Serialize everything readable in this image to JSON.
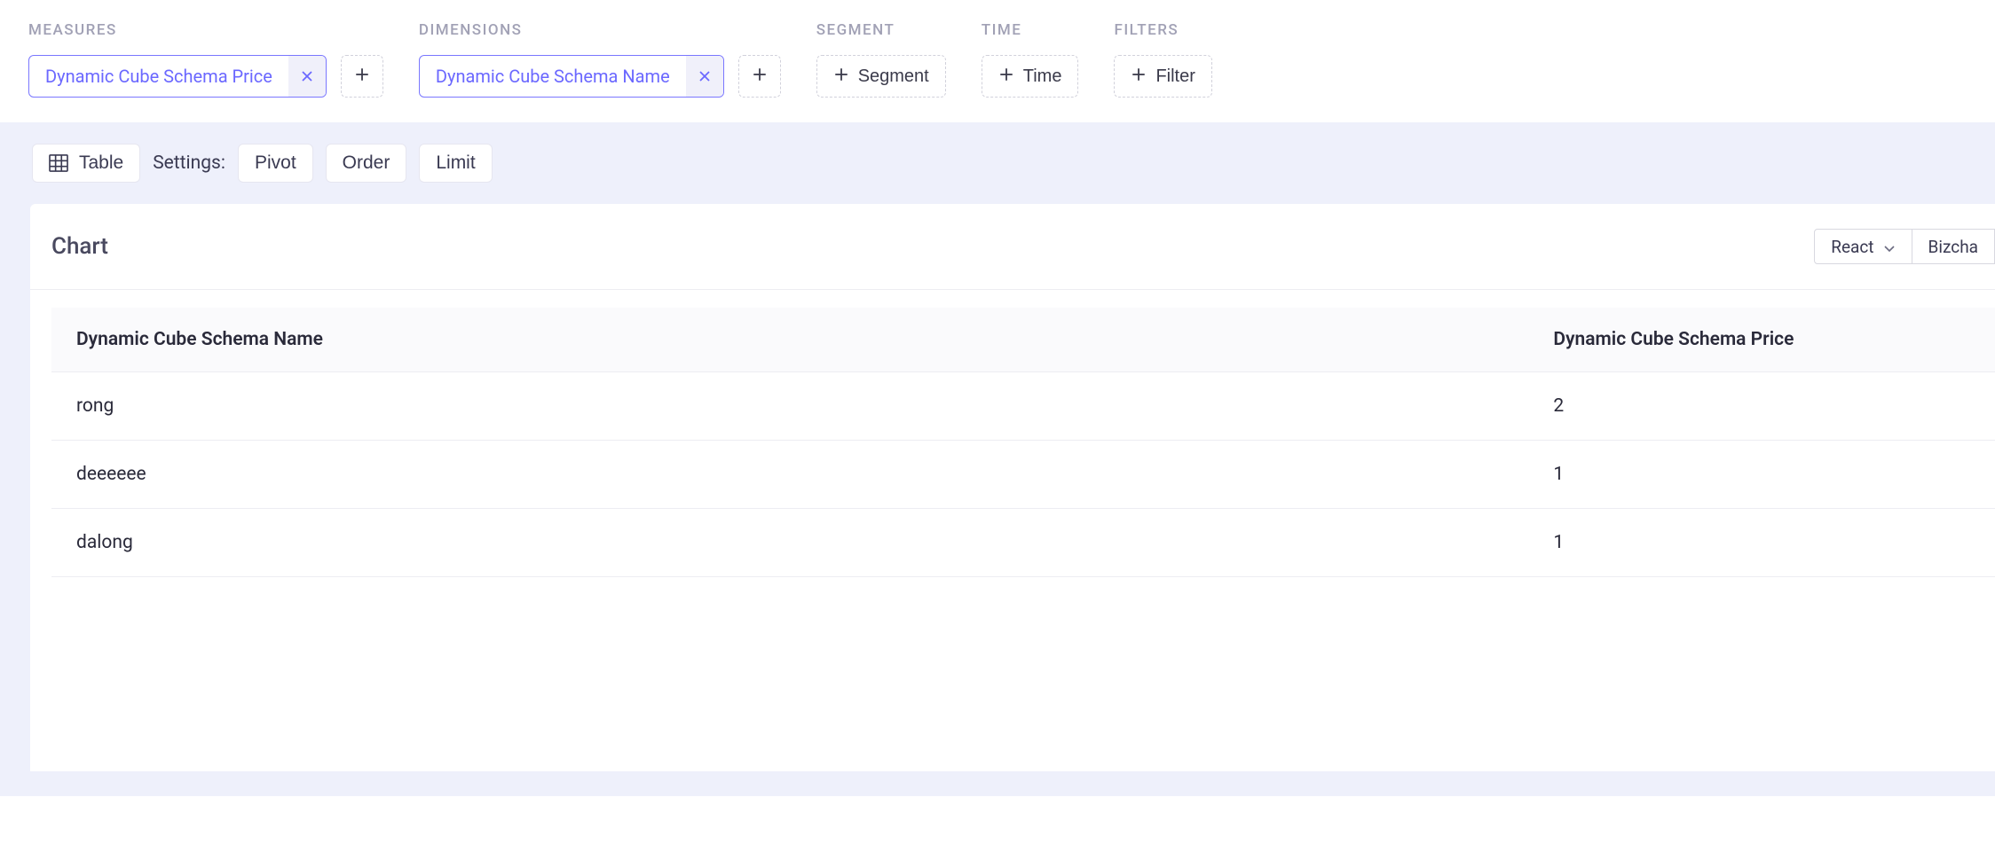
{
  "sections": {
    "measures": {
      "label": "MEASURES",
      "tags": [
        {
          "text": "Dynamic Cube Schema Price"
        }
      ]
    },
    "dimensions": {
      "label": "DIMENSIONS",
      "tags": [
        {
          "text": "Dynamic Cube Schema Name"
        }
      ]
    },
    "segment": {
      "label": "SEGMENT",
      "button": "Segment"
    },
    "time": {
      "label": "TIME",
      "button": "Time"
    },
    "filters": {
      "label": "FILTERS",
      "button": "Filter"
    }
  },
  "settings": {
    "table_btn": "Table",
    "settings_label": "Settings:",
    "pivot_btn": "Pivot",
    "order_btn": "Order",
    "limit_btn": "Limit"
  },
  "chart": {
    "title": "Chart",
    "framework_select": "React",
    "lib_select": "Bizcha"
  },
  "table": {
    "headers": {
      "name": "Dynamic Cube Schema Name",
      "price": "Dynamic Cube Schema Price"
    },
    "rows": [
      {
        "name": "rong",
        "price": "2"
      },
      {
        "name": "deeeeee",
        "price": "1"
      },
      {
        "name": "dalong",
        "price": "1"
      }
    ]
  }
}
